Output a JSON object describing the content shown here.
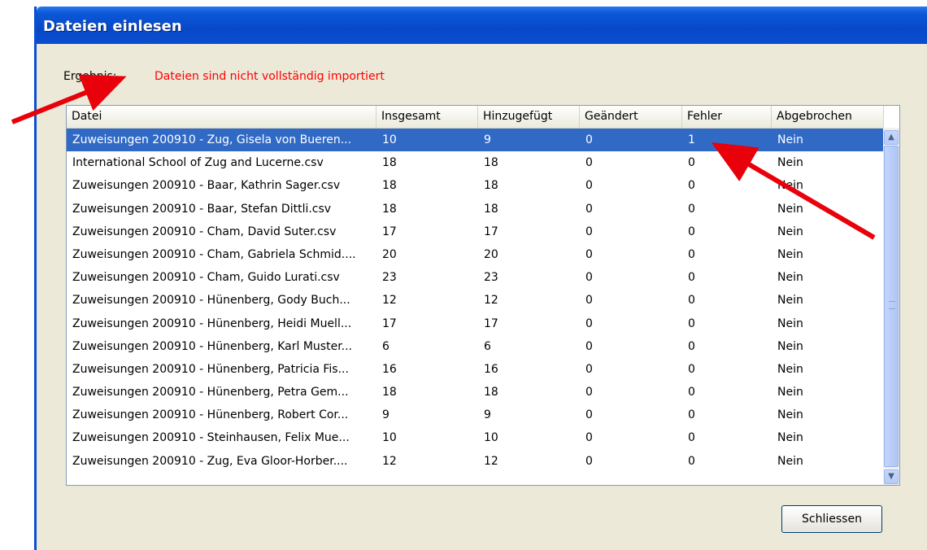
{
  "window": {
    "title": "Dateien einlesen"
  },
  "result": {
    "label": "Ergebnis:",
    "value": "Dateien sind nicht vollständig importiert"
  },
  "table": {
    "columns": [
      "Datei",
      "Insgesamt",
      "Hinzugefügt",
      "Geändert",
      "Fehler",
      "Abgebrochen"
    ],
    "rows": [
      [
        "Zuweisungen 200910 - Zug, Gisela von Bueren...",
        "10",
        "9",
        "0",
        "1",
        "Nein"
      ],
      [
        "International School of Zug and Lucerne.csv",
        "18",
        "18",
        "0",
        "0",
        "Nein"
      ],
      [
        "Zuweisungen 200910 - Baar, Kathrin Sager.csv",
        "18",
        "18",
        "0",
        "0",
        "Nein"
      ],
      [
        "Zuweisungen 200910 - Baar, Stefan Dittli.csv",
        "18",
        "18",
        "0",
        "0",
        "Nein"
      ],
      [
        "Zuweisungen 200910 - Cham, David Suter.csv",
        "17",
        "17",
        "0",
        "0",
        "Nein"
      ],
      [
        "Zuweisungen 200910 - Cham, Gabriela Schmid....",
        "20",
        "20",
        "0",
        "0",
        "Nein"
      ],
      [
        "Zuweisungen 200910 - Cham, Guido Lurati.csv",
        "23",
        "23",
        "0",
        "0",
        "Nein"
      ],
      [
        "Zuweisungen 200910 - Hünenberg, Gody Buch...",
        "12",
        "12",
        "0",
        "0",
        "Nein"
      ],
      [
        "Zuweisungen 200910 - Hünenberg, Heidi Muell...",
        "17",
        "17",
        "0",
        "0",
        "Nein"
      ],
      [
        "Zuweisungen 200910 - Hünenberg, Karl Muster...",
        "6",
        "6",
        "0",
        "0",
        "Nein"
      ],
      [
        "Zuweisungen 200910 - Hünenberg, Patricia Fis...",
        "16",
        "16",
        "0",
        "0",
        "Nein"
      ],
      [
        "Zuweisungen 200910 - Hünenberg, Petra Gem...",
        "18",
        "18",
        "0",
        "0",
        "Nein"
      ],
      [
        "Zuweisungen 200910 - Hünenberg, Robert Cor...",
        "9",
        "9",
        "0",
        "0",
        "Nein"
      ],
      [
        "Zuweisungen 200910 - Steinhausen, Felix Mue...",
        "10",
        "10",
        "0",
        "0",
        "Nein"
      ],
      [
        "Zuweisungen 200910 - Zug, Eva Gloor-Horber....",
        "12",
        "12",
        "0",
        "0",
        "Nein"
      ]
    ]
  },
  "buttons": {
    "close": "Schliessen"
  },
  "colors": {
    "selection": "#316ac5",
    "error_text": "#ff0000",
    "arrow": "#e8000b"
  },
  "icons": {
    "scroll_up": "chevron-up-icon",
    "scroll_down": "chevron-down-icon"
  }
}
